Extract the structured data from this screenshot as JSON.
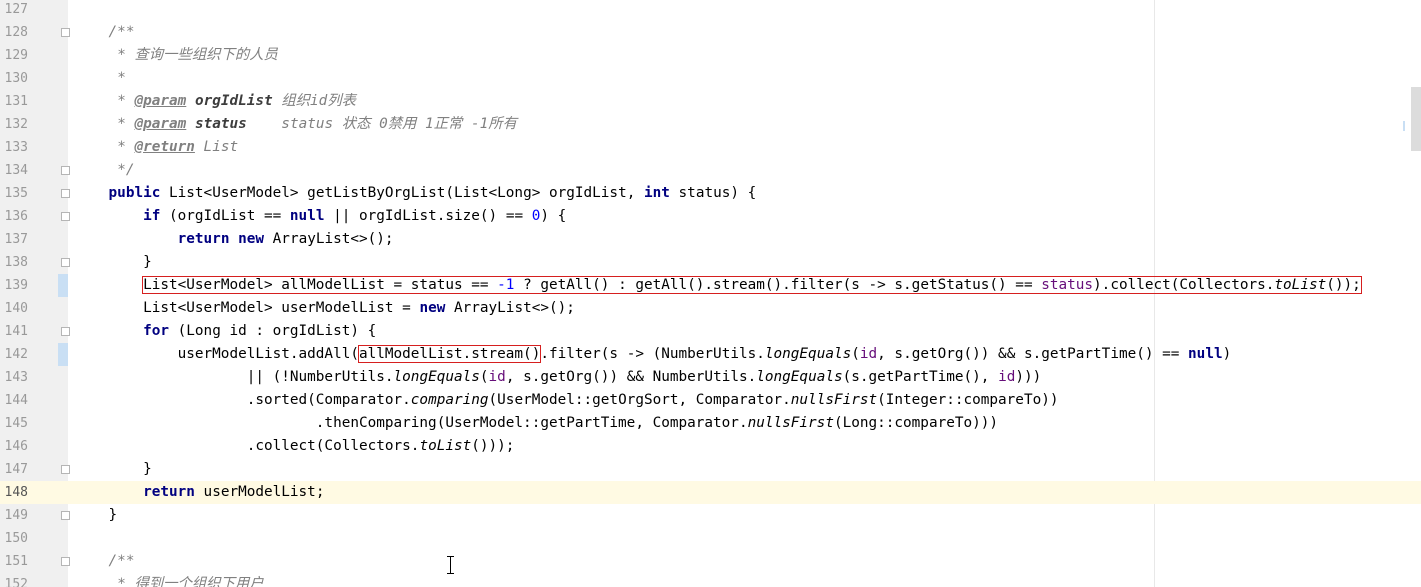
{
  "editor": {
    "lines": [
      {
        "num": "127",
        "fold": false,
        "mark": false,
        "current": false,
        "segs": []
      },
      {
        "num": "128",
        "fold": true,
        "mark": false,
        "current": false,
        "segs": [
          [
            "    ",
            ""
          ],
          [
            "/**",
            "cm"
          ]
        ]
      },
      {
        "num": "129",
        "fold": false,
        "mark": false,
        "current": false,
        "segs": [
          [
            "     ",
            ""
          ],
          [
            "* 查询一些组织下的人员",
            "cm"
          ]
        ]
      },
      {
        "num": "130",
        "fold": false,
        "mark": false,
        "current": false,
        "segs": [
          [
            "     ",
            ""
          ],
          [
            "*",
            "cm"
          ]
        ]
      },
      {
        "num": "131",
        "fold": false,
        "mark": false,
        "current": false,
        "segs": [
          [
            "     ",
            ""
          ],
          [
            "* ",
            "cm"
          ],
          [
            "@param",
            "tag"
          ],
          [
            " ",
            "cm"
          ],
          [
            "orgIdList",
            "pn"
          ],
          [
            " 组织id列表",
            "cm"
          ]
        ]
      },
      {
        "num": "132",
        "fold": false,
        "mark": false,
        "current": false,
        "segs": [
          [
            "     ",
            ""
          ],
          [
            "* ",
            "cm"
          ],
          [
            "@param",
            "tag"
          ],
          [
            " ",
            "cm"
          ],
          [
            "status",
            "pn"
          ],
          [
            "    status 状态 0禁用 1正常 -1所有",
            "cm"
          ]
        ]
      },
      {
        "num": "133",
        "fold": false,
        "mark": false,
        "current": false,
        "segs": [
          [
            "     ",
            ""
          ],
          [
            "* ",
            "cm"
          ],
          [
            "@return",
            "tag"
          ],
          [
            " List",
            "cm"
          ]
        ]
      },
      {
        "num": "134",
        "fold": true,
        "mark": false,
        "current": false,
        "segs": [
          [
            "     ",
            ""
          ],
          [
            "*/",
            "cm"
          ]
        ]
      },
      {
        "num": "135",
        "fold": true,
        "mark": false,
        "current": false,
        "segs": [
          [
            "    ",
            ""
          ],
          [
            "public",
            "kw"
          ],
          [
            " List<UserModel> getListByOrgList(List<Long> orgIdList, ",
            ""
          ],
          [
            "int",
            "kw"
          ],
          [
            " status) {",
            ""
          ]
        ]
      },
      {
        "num": "136",
        "fold": true,
        "mark": false,
        "current": false,
        "segs": [
          [
            "        ",
            ""
          ],
          [
            "if",
            "kw"
          ],
          [
            " (orgIdList == ",
            ""
          ],
          [
            "null",
            "kw"
          ],
          [
            " || orgIdList.size() == ",
            ""
          ],
          [
            "0",
            "num"
          ],
          [
            ") {",
            ""
          ]
        ]
      },
      {
        "num": "137",
        "fold": false,
        "mark": false,
        "current": false,
        "segs": [
          [
            "            ",
            ""
          ],
          [
            "return",
            "kw"
          ],
          [
            " ",
            ""
          ],
          [
            "new",
            "kw"
          ],
          [
            " ArrayList<>();",
            ""
          ]
        ]
      },
      {
        "num": "138",
        "fold": true,
        "mark": false,
        "current": false,
        "segs": [
          [
            "        }",
            ""
          ]
        ]
      },
      {
        "num": "139",
        "fold": false,
        "mark": true,
        "current": false,
        "segs": [
          [
            "        ",
            ""
          ],
          [
            "List<UserModel> allModelList = status == ",
            "box-start"
          ],
          [
            "-1",
            "num"
          ],
          [
            " ? getAll() : getAll().stream().filter(s -> s.getStatus() == ",
            ""
          ],
          [
            "status",
            "fld"
          ],
          [
            ").collect(Collectors.",
            ""
          ],
          [
            "toList",
            "st"
          ],
          [
            "());",
            "box-end"
          ]
        ]
      },
      {
        "num": "140",
        "fold": false,
        "mark": false,
        "current": false,
        "segs": [
          [
            "        List<UserModel> userModelList = ",
            ""
          ],
          [
            "new",
            "kw"
          ],
          [
            " ArrayList<>();",
            ""
          ]
        ]
      },
      {
        "num": "141",
        "fold": true,
        "mark": false,
        "current": false,
        "segs": [
          [
            "        ",
            ""
          ],
          [
            "for",
            "kw"
          ],
          [
            " (Long id : orgIdList) {",
            ""
          ]
        ]
      },
      {
        "num": "142",
        "fold": false,
        "mark": true,
        "current": false,
        "segs": [
          [
            "            userModelList.addAll(",
            ""
          ],
          [
            "allModelList.stream()",
            "boxed"
          ],
          [
            ".filter(s -> (NumberUtils.",
            ""
          ],
          [
            "longEquals",
            "st"
          ],
          [
            "(",
            ""
          ],
          [
            "id",
            "fld"
          ],
          [
            ", s.getOrg()) && s.getPartTime() == ",
            ""
          ],
          [
            "null",
            "kw"
          ],
          [
            ")",
            ""
          ]
        ]
      },
      {
        "num": "143",
        "fold": false,
        "mark": false,
        "current": false,
        "segs": [
          [
            "                    || (!NumberUtils.",
            ""
          ],
          [
            "longEquals",
            "st"
          ],
          [
            "(",
            ""
          ],
          [
            "id",
            "fld"
          ],
          [
            ", s.getOrg()) && NumberUtils.",
            ""
          ],
          [
            "longEquals",
            "st"
          ],
          [
            "(s.getPartTime(), ",
            ""
          ],
          [
            "id",
            "fld"
          ],
          [
            ")))",
            ""
          ]
        ]
      },
      {
        "num": "144",
        "fold": false,
        "mark": false,
        "current": false,
        "segs": [
          [
            "                    .sorted(Comparator.",
            ""
          ],
          [
            "comparing",
            "st"
          ],
          [
            "(UserModel::getOrgSort, Comparator.",
            ""
          ],
          [
            "nullsFirst",
            "st"
          ],
          [
            "(Integer::compareTo))",
            ""
          ]
        ]
      },
      {
        "num": "145",
        "fold": false,
        "mark": false,
        "current": false,
        "segs": [
          [
            "                            .thenComparing(UserModel::getPartTime, Comparator.",
            ""
          ],
          [
            "nullsFirst",
            "st"
          ],
          [
            "(Long::compareTo)))",
            ""
          ]
        ]
      },
      {
        "num": "146",
        "fold": false,
        "mark": false,
        "current": false,
        "segs": [
          [
            "                    .collect(Collectors.",
            ""
          ],
          [
            "toList",
            "st"
          ],
          [
            "()));",
            ""
          ]
        ]
      },
      {
        "num": "147",
        "fold": true,
        "mark": false,
        "current": false,
        "segs": [
          [
            "        }",
            ""
          ]
        ]
      },
      {
        "num": "148",
        "fold": false,
        "mark": false,
        "current": true,
        "segs": [
          [
            "        ",
            ""
          ],
          [
            "return",
            "kw"
          ],
          [
            " userModelList;",
            ""
          ]
        ]
      },
      {
        "num": "149",
        "fold": true,
        "mark": false,
        "current": false,
        "segs": [
          [
            "    }",
            ""
          ]
        ]
      },
      {
        "num": "150",
        "fold": false,
        "mark": false,
        "current": false,
        "segs": []
      },
      {
        "num": "151",
        "fold": true,
        "mark": false,
        "current": false,
        "segs": [
          [
            "    ",
            ""
          ],
          [
            "/**",
            "cm"
          ]
        ]
      },
      {
        "num": "152",
        "fold": false,
        "mark": false,
        "current": false,
        "segs": [
          [
            "     ",
            ""
          ],
          [
            "* 得到一个组织下用户",
            "cm"
          ]
        ]
      }
    ]
  },
  "colors": {
    "keyword": "#000080",
    "comment": "#808080",
    "number": "#0000ff",
    "field": "#660e7a",
    "highlight_box": "#d61f1f",
    "current_line": "#fffae3",
    "gutter": "#f0f0f0"
  },
  "cursor": "text-ibeam"
}
